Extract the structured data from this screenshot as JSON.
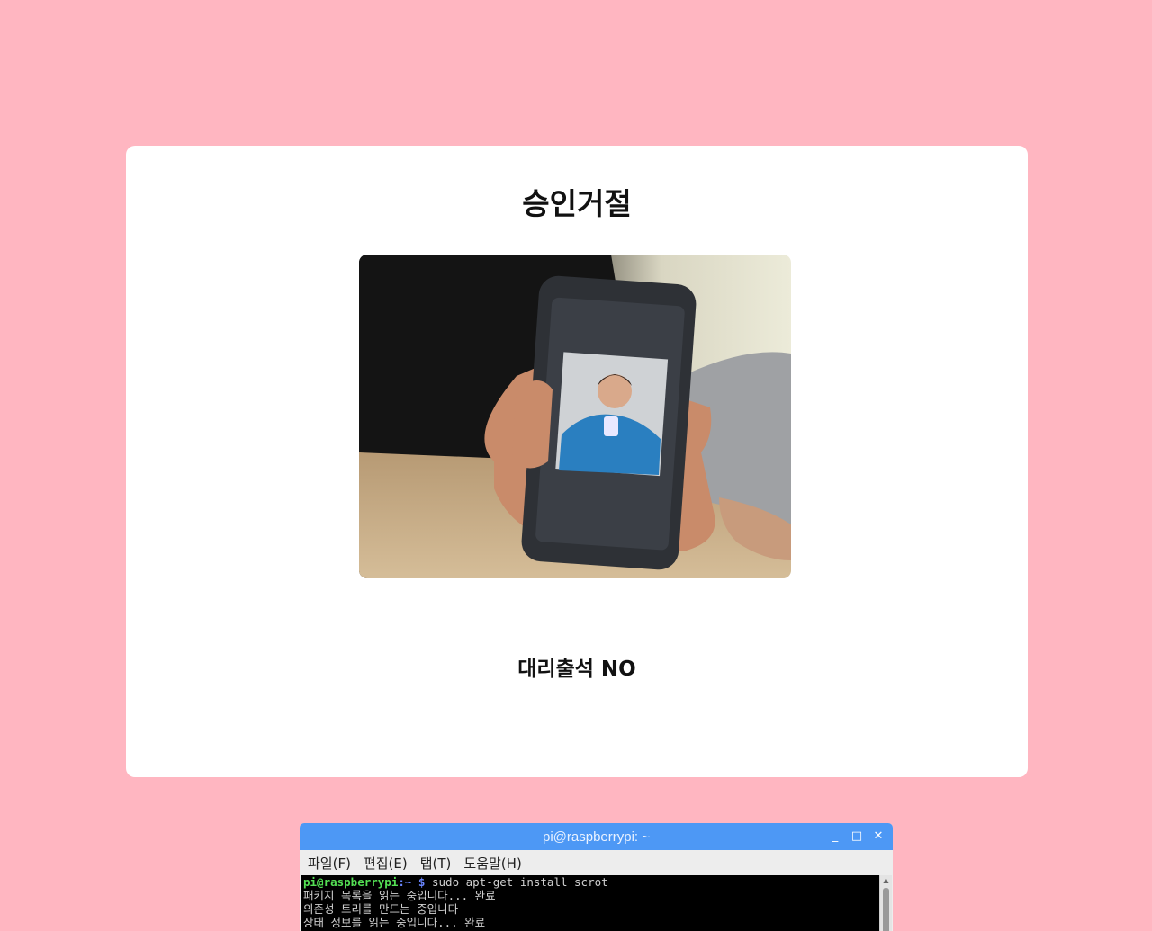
{
  "card": {
    "title": "승인거절",
    "result": "대리출석 NO"
  },
  "terminal": {
    "window_title": "pi@raspberrypi: ~",
    "buttons": {
      "minimize": "_",
      "maximize": "□",
      "close": "✕"
    },
    "menu": [
      "파일(F)",
      "편집(E)",
      "탭(T)",
      "도움말(H)"
    ],
    "prompt_user": "pi@raspberrypi",
    "prompt_path": ":~ $",
    "command": " sudo apt-get install scrot",
    "output": [
      "패키지 목록을 읽는 중입니다... 완료",
      "의존성 트리를 만드는 중입니다",
      "상태 정보를 읽는 중입니다... 완료"
    ]
  },
  "colors": {
    "page_bg": "#ffb6c1",
    "titlebar": "#4d98f5"
  }
}
